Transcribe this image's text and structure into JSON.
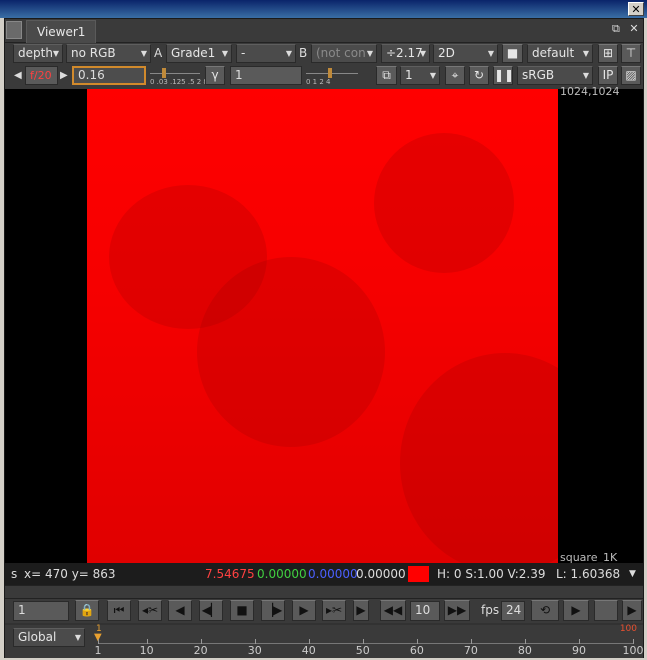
{
  "window": {
    "close_glyph": "✕"
  },
  "tab": {
    "label": "Viewer1",
    "float_glyph": "⧉",
    "close_glyph": "✕"
  },
  "toolbar_row1": {
    "channels": "depth",
    "rgb": "no RGB",
    "a_label": "A",
    "a_input": "Grade1",
    "compare": "-",
    "b_label": "B",
    "b_input": "(not con",
    "zoom": "÷2.17",
    "view_mode": "2D",
    "camera_icon": "camera-icon",
    "lut_preset": "default",
    "dots_icon": "node-graph-icon",
    "tree_icon": "hierarchy-icon"
  },
  "toolbar_row2": {
    "frame_field": "f/20",
    "gain_value": "0.16",
    "gain_ticks": "0 .03 .125 .5 2 8 32",
    "gamma_label": "γ",
    "gamma_value": "1",
    "gamma_ticks": "0 1 2 4",
    "proxy": "1",
    "colorspace": "sRGB",
    "ip_label": "IP"
  },
  "viewer": {
    "resolution": "1024,1024",
    "format": "square_1K",
    "image_color": "#ff0000"
  },
  "status": {
    "prefix": "s",
    "coords": "x= 470 y= 863",
    "r": "7.54675",
    "g": "0.00000",
    "b": "0.00000",
    "a": "0.00000",
    "swatch": "#ff0000",
    "hsv": "H:  0 S:1.00 V:2.39",
    "lum": "L: 1.60368",
    "r_color": "#ff4040",
    "g_color": "#40d040",
    "b_color": "#4a60ff"
  },
  "transport": {
    "current_frame": "1",
    "skip_frames": "10",
    "fps_label": "fps",
    "fps_value": "24"
  },
  "timeline": {
    "scope": "Global",
    "start_marker": "1",
    "end_marker": "100",
    "ticks": [
      "1",
      "10",
      "20",
      "30",
      "40",
      "50",
      "60",
      "70",
      "80",
      "90",
      "100"
    ]
  }
}
